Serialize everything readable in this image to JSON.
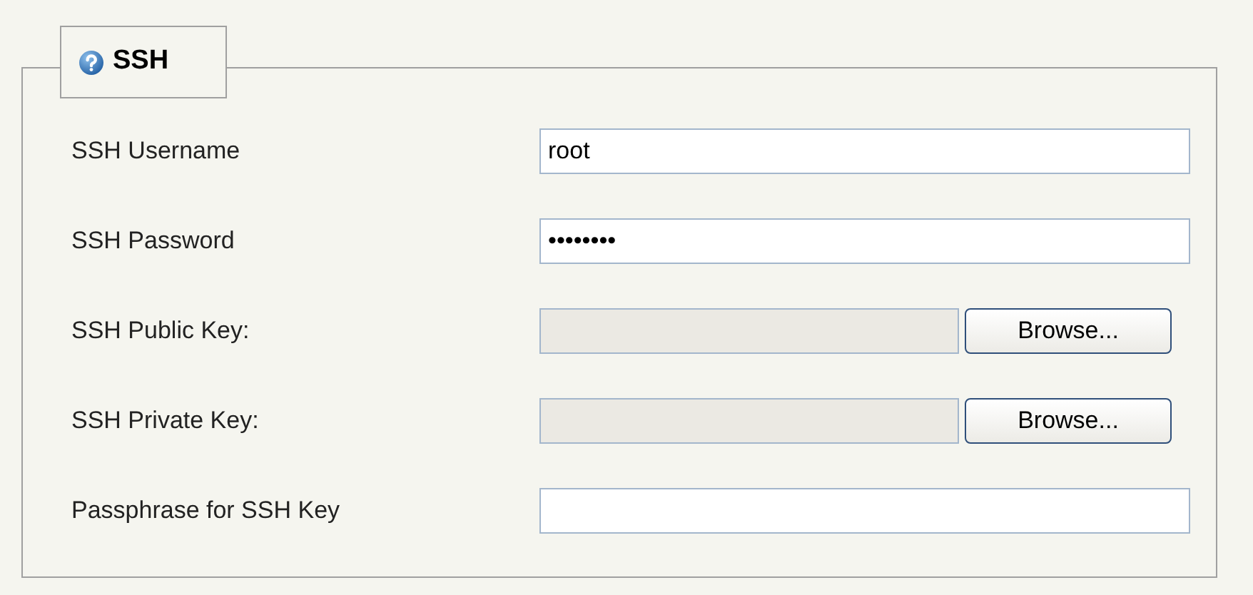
{
  "section": {
    "title": "SSH"
  },
  "fields": [
    {
      "kind": "text",
      "label": "SSH Username",
      "value": "root"
    },
    {
      "kind": "text",
      "label": "SSH Password",
      "value": "••••••••"
    },
    {
      "kind": "file",
      "label": "SSH Public Key:",
      "button": "Browse..."
    },
    {
      "kind": "file",
      "label": "SSH Private Key:",
      "button": "Browse..."
    },
    {
      "kind": "text",
      "label": "Passphrase for SSH Key"
    }
  ]
}
